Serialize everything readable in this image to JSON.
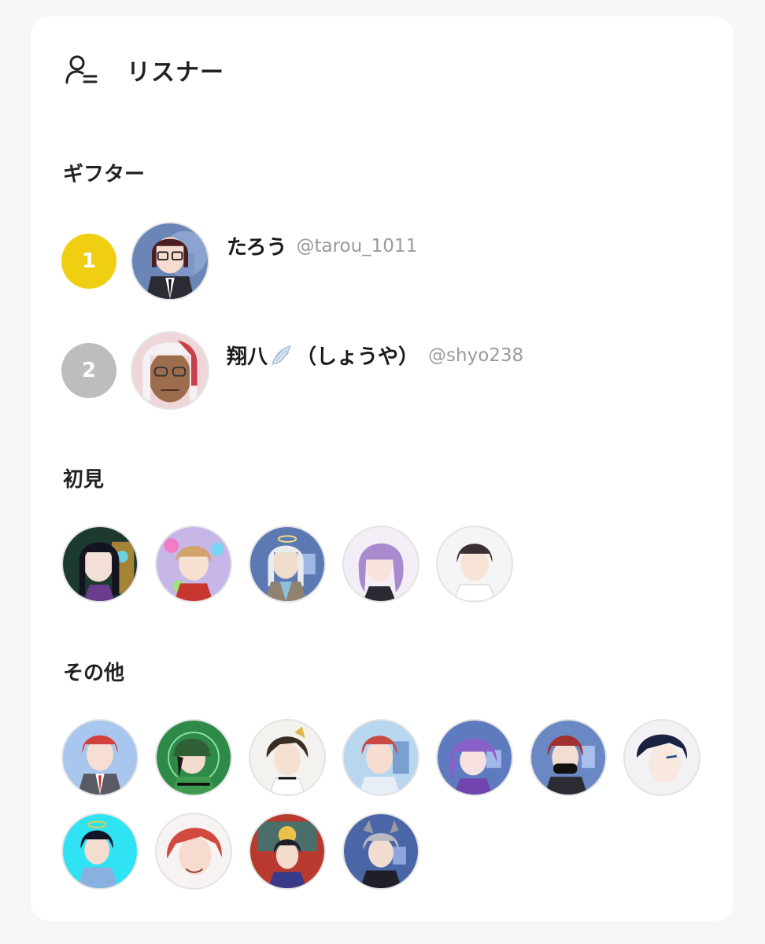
{
  "header": {
    "title": "リスナー",
    "icon": "user-list-icon"
  },
  "sections": {
    "gifters": {
      "title": "ギフター",
      "items": [
        {
          "rank": "1",
          "name": "たろう",
          "handle": "@tarou_1011",
          "badge_color": "#f0cf13"
        },
        {
          "rank": "2",
          "name": "翔八",
          "name_suffix": "（しょうや）",
          "handle": "@shyo238",
          "badge_color": "#bdbdbd",
          "name_icon": "wing-icon"
        }
      ]
    },
    "first_time": {
      "title": "初見",
      "avatar_count": 5
    },
    "others": {
      "title": "その他",
      "avatar_count": 11
    }
  },
  "colors": {
    "background": "#f7f7f7",
    "card": "#ffffff",
    "rank_gold": "#f0cf13",
    "rank_silver": "#bdbdbd",
    "handle_text": "#9a9a9a"
  }
}
